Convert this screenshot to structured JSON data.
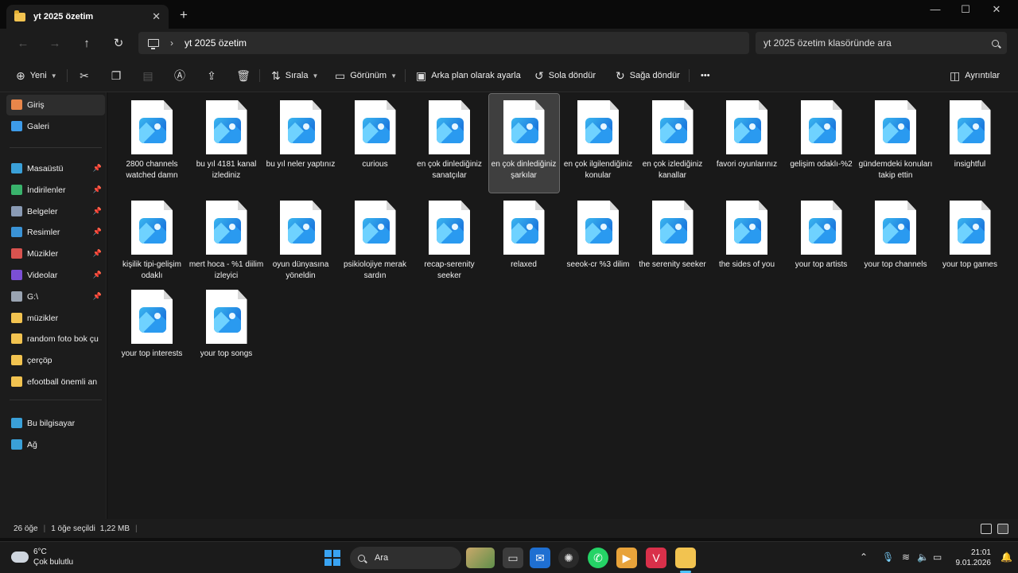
{
  "window": {
    "tab_title": "yt 2025 özetim",
    "tab_close": "✕",
    "new_tab": "+",
    "minimize": "—",
    "maximize": "☐",
    "close": "✕"
  },
  "address": {
    "path": "yt 2025 özetim",
    "search_placeholder": "yt 2025 özetim klasöründe ara"
  },
  "toolbar": {
    "new_label": "Yeni",
    "sort_label": "Sırala",
    "view_label": "Görünüm",
    "set_background_label": "Arka plan olarak ayarla",
    "rotate_left_label": "Sola döndür",
    "rotate_right_label": "Sağa döndür",
    "more_label": "•••",
    "details_label": "Ayrıntılar"
  },
  "sidebar": {
    "top": [
      {
        "label": "Giriş",
        "icon": "home-icon",
        "color": "#e8864a",
        "selected": true
      },
      {
        "label": "Galeri",
        "icon": "gallery-icon",
        "color": "#3d9be9"
      }
    ],
    "pinned": [
      {
        "label": "Masaüstü",
        "icon": "desktop-icon",
        "color": "#3aa0d8",
        "pinned": true
      },
      {
        "label": "İndirilenler",
        "icon": "downloads-icon",
        "color": "#39b36c",
        "pinned": true
      },
      {
        "label": "Belgeler",
        "icon": "documents-icon",
        "color": "#8a9bb5",
        "pinned": true
      },
      {
        "label": "Resimler",
        "icon": "pictures-icon",
        "color": "#3a93d6",
        "pinned": true
      },
      {
        "label": "Müzikler",
        "icon": "music-icon",
        "color": "#d9534f",
        "pinned": true
      },
      {
        "label": "Videolar",
        "icon": "videos-icon",
        "color": "#7b4fd6",
        "pinned": true
      },
      {
        "label": "G:\\",
        "icon": "drive-icon",
        "color": "#9aa4b2",
        "pinned": true
      },
      {
        "label": "müzikler",
        "icon": "folder-icon",
        "color": "#f2c350"
      },
      {
        "label": "random foto bok çu",
        "icon": "folder-icon",
        "color": "#f2c350"
      },
      {
        "label": "çerçöp",
        "icon": "folder-icon",
        "color": "#f2c350"
      },
      {
        "label": "efootball önemli an",
        "icon": "folder-icon",
        "color": "#f2c350"
      }
    ],
    "bottom": [
      {
        "label": "Bu bilgisayar",
        "icon": "this-pc-icon",
        "color": "#3aa0d8"
      },
      {
        "label": "Ağ",
        "icon": "network-icon",
        "color": "#3aa0d8"
      }
    ]
  },
  "files": [
    {
      "name": "2800 channels watched damn"
    },
    {
      "name": "bu yıl 4181 kanal izlediniz"
    },
    {
      "name": "bu yıl neler yaptınız"
    },
    {
      "name": "curious"
    },
    {
      "name": "en çok dinlediğiniz sanatçılar"
    },
    {
      "name": "en çok dinlediğiniz şarkılar",
      "selected": true
    },
    {
      "name": "en çok ilgilendiğiniz konular"
    },
    {
      "name": "en çok izlediğiniz kanallar"
    },
    {
      "name": "favori oyunlarınız"
    },
    {
      "name": "gelişim odaklı-%2"
    },
    {
      "name": "gündemdeki konuları takip ettin"
    },
    {
      "name": "insightful"
    },
    {
      "name": "kişilik tipi-gelişim odaklı"
    },
    {
      "name": "mert hoca - %1 diilim izleyici"
    },
    {
      "name": "oyun dünyasına yöneldin"
    },
    {
      "name": "psikiolojiye merak sardın"
    },
    {
      "name": "recap-serenity seeker"
    },
    {
      "name": "relaxed"
    },
    {
      "name": "seeok-cr %3 dilim"
    },
    {
      "name": "the serenity seeker"
    },
    {
      "name": "the sides of you"
    },
    {
      "name": "your top artists"
    },
    {
      "name": "your top channels"
    },
    {
      "name": "your top games"
    },
    {
      "name": "your top interests"
    },
    {
      "name": "your top songs"
    }
  ],
  "status": {
    "count": "26 öğe",
    "selection": "1 öğe seçildi",
    "size": "1,22 MB"
  },
  "taskbar": {
    "temperature": "6°C",
    "condition": "Çok bulutlu",
    "search_label": "Ara",
    "time": "21:01",
    "date": "9.01.2026"
  }
}
